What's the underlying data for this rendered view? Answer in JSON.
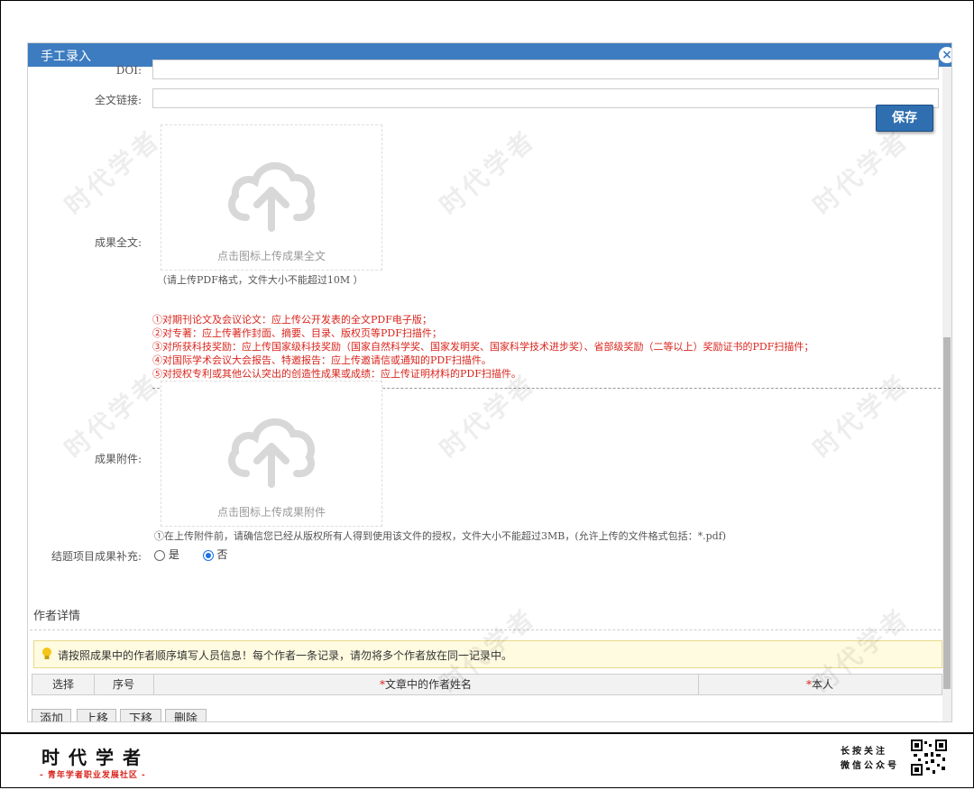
{
  "dialog": {
    "title": "手工录入",
    "save_label": "保存"
  },
  "form": {
    "doi_label": "DOI:",
    "fulltext_link_label": "全文链接:",
    "fulltext_label": "成果全文:",
    "fulltext_upload_caption": "点击图标上传成果全文",
    "fulltext_hint": "（请上传PDF格式，文件大小不能超过10M ）",
    "fulltext_rules": [
      "①对期刊论文及会议论文：应上传公开发表的全文PDF电子版；",
      "②对专著：应上传著作封面、摘要、目录、版权页等PDF扫描件；",
      "③对所获科技奖励：应上传国家级科技奖励（国家自然科学奖、国家发明奖、国家科学技术进步奖）、省部级奖励（二等以上）奖励证书的PDF扫描件；",
      "④对国际学术会议大会报告、特邀报告：应上传邀请信或通知的PDF扫描件。",
      "⑤对授权专利或其他公认突出的创造性成果或成绩：应上传证明材料的PDF扫描件。"
    ],
    "attachment_label": "成果附件:",
    "attachment_upload_caption": "点击图标上传成果附件",
    "attachment_hint": "①在上传附件前，请确信您已经从版权所有人得到使用该文件的授权，文件大小不能超过3MB，(允许上传的文件格式包括：*.pdf)",
    "supplement_label": "结题项目成果补充:",
    "radio_yes": "是",
    "radio_no": "否",
    "radio_selected": "否"
  },
  "authors": {
    "section_title": "作者详情",
    "notice": "请按照成果中的作者顺序填写人员信息！每个作者一条记录，请勿将多个作者放在同一记录中。",
    "columns": {
      "select": "选择",
      "order": "序号",
      "name_required": "*",
      "name": "文章中的作者姓名",
      "self_required": "*",
      "self": "本人"
    },
    "buttons": {
      "add": "添加",
      "up": "上移",
      "down": "下移",
      "delete": "删除"
    }
  },
  "watermark_text": "时代学者",
  "footer": {
    "brand": "时代学者",
    "brand_sub": "- 青年学者职业发展社区 -",
    "follow_line1": "长按关注",
    "follow_line2": "微信公众号"
  },
  "colors": {
    "titlebar": "#3d7cc0",
    "accent_red": "#d9251d",
    "save_button": "#2f6fb0"
  }
}
